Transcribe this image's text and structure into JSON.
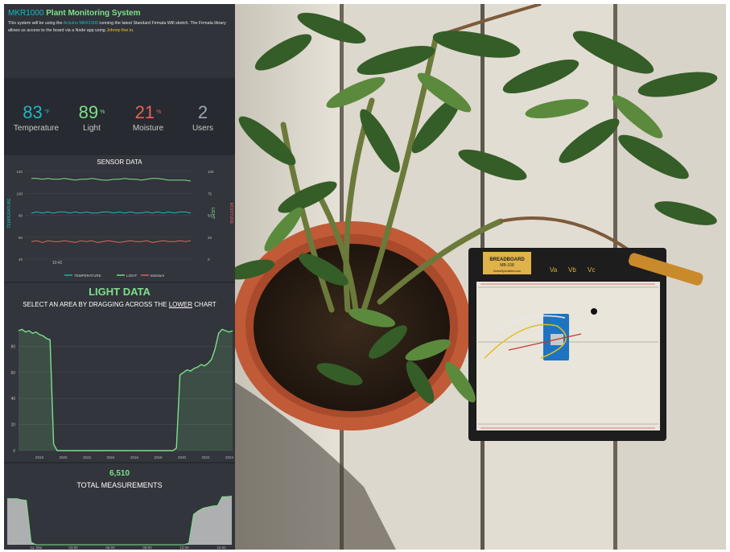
{
  "header": {
    "title_prefix": "MKR1000",
    "title": "Plant Monitoring System",
    "desc_1": "This system will be using the ",
    "desc_link_1": "Arduino MKR1000",
    "desc_2": " running the latest Standard Firmata Wifi sketch. The Firmata library allows us access to the board via a Node app using ",
    "desc_link_2": "Johnny-five.io",
    "desc_3": "."
  },
  "stats": [
    {
      "value": "83",
      "unit": "°F",
      "label": "Temperature",
      "color": "#1fb6c1"
    },
    {
      "value": "89",
      "unit": "%",
      "label": "Light",
      "color": "#7ee08b"
    },
    {
      "value": "21",
      "unit": "%",
      "label": "Moisture",
      "color": "#e8605d"
    },
    {
      "value": "2",
      "unit": "",
      "label": "Users",
      "color": "#9aa6b5"
    }
  ],
  "sensor_panel": {
    "title": "SENSOR DATA",
    "y_left_label": "TEMPERATURE",
    "y_right_label_1": "LIGHT",
    "y_right_label_2": "MOISTURE",
    "x_tick": "10:42",
    "y_left_ticks": [
      "120",
      "100",
      "80",
      "60",
      "40"
    ],
    "y_right_ticks": [
      "100",
      "75",
      "50",
      "25",
      "0"
    ],
    "legend": [
      "TEMPERATURE",
      "LIGHT",
      "Moisture"
    ]
  },
  "light_panel": {
    "title": "LIGHT DATA",
    "subtitle_1": "SELECT AN AREA BY DRAGGING ACROSS THE ",
    "subtitle_u": "LOWER",
    "subtitle_2": " CHART",
    "y_ticks": [
      "80",
      "60",
      "40",
      "20",
      "0"
    ],
    "x_ticks": [
      "2018",
      "2020",
      "2022",
      "2024",
      "2016",
      "2018",
      "2020",
      "2022",
      "2024"
    ]
  },
  "total_panel": {
    "count": "6,510",
    "label": "TOTAL MEASUREMENTS",
    "x_ticks": [
      "11. Mar",
      "03:00",
      "06:00",
      "09:00",
      "12:00",
      "15:00"
    ]
  },
  "colors": {
    "teal": "#1fb6c1",
    "green": "#7ee08b",
    "red": "#e8605d",
    "panel_bg": "#32353b",
    "page_bg": "#272a30"
  },
  "chart_data": [
    {
      "type": "line",
      "title": "SENSOR DATA",
      "series": [
        {
          "name": "TEMPERATURE",
          "axis": "left",
          "values": [
            82,
            83,
            82,
            83,
            82,
            83,
            83,
            82,
            83,
            82,
            83,
            82,
            82,
            83,
            83,
            82,
            83,
            82,
            83,
            82,
            82,
            83,
            82,
            83,
            82,
            83,
            82,
            83,
            83,
            82
          ]
        },
        {
          "name": "LIGHT",
          "axis": "right",
          "values": [
            92,
            92,
            91,
            92,
            91,
            91,
            92,
            91,
            90,
            91,
            91,
            92,
            91,
            90,
            90,
            91,
            91,
            92,
            91,
            91,
            90,
            91,
            92,
            92,
            91,
            90,
            90,
            90,
            90,
            89
          ]
        },
        {
          "name": "Moisture",
          "axis": "right",
          "values": [
            20,
            21,
            19,
            21,
            20,
            20,
            21,
            20,
            19,
            21,
            20,
            21,
            19,
            20,
            21,
            20,
            19,
            20,
            21,
            20,
            20,
            21,
            19,
            20,
            21,
            20,
            20,
            21,
            20,
            21
          ]
        }
      ],
      "ylim_left": [
        40,
        120
      ],
      "ylim_right": [
        0,
        100
      ],
      "legend": "bottom"
    },
    {
      "type": "area",
      "title": "LIGHT DATA",
      "values": [
        92,
        93,
        91,
        92,
        90,
        91,
        89,
        88,
        86,
        85,
        5,
        0,
        0,
        0,
        0,
        0,
        0,
        0,
        0,
        0,
        0,
        0,
        0,
        0,
        0,
        0,
        0,
        0,
        0,
        0,
        0,
        0,
        0,
        0,
        0,
        0,
        0,
        0,
        0,
        0,
        0,
        0,
        0,
        0,
        0,
        2,
        58,
        60,
        62,
        61,
        63,
        64,
        66,
        65,
        67,
        70,
        78,
        90,
        93,
        92,
        91,
        92
      ],
      "ylim": [
        0,
        100
      ]
    },
    {
      "type": "area",
      "title": "TOTAL MEASUREMENTS",
      "values": [
        88,
        88,
        88,
        86,
        85,
        5,
        0,
        0,
        0,
        0,
        0,
        0,
        0,
        0,
        0,
        0,
        0,
        0,
        0,
        0,
        0,
        0,
        0,
        0,
        0,
        0,
        0,
        0,
        0,
        0,
        0,
        0,
        0,
        0,
        0,
        0,
        0,
        0,
        3,
        58,
        65,
        70,
        72,
        74,
        75,
        92,
        92,
        93
      ],
      "ylim": [
        0,
        100
      ]
    }
  ],
  "photo": {
    "breadboard_label_1": "BREADBOARD",
    "breadboard_label_2": "MB-108",
    "breadboard_label_3": "GlobalSpecialties.com",
    "terminal_labels": [
      "Va",
      "Vb",
      "Vc"
    ]
  }
}
